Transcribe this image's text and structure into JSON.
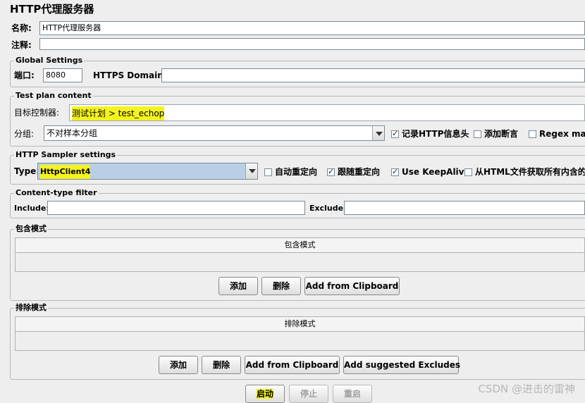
{
  "page": {
    "title": "HTTP代理服务器",
    "name_label": "名称:",
    "name_value": "HTTP代理服务器",
    "comment_label": "注释:",
    "comment_value": ""
  },
  "global_settings": {
    "legend": "Global Settings",
    "port_label": "端口:",
    "port_value": "8080",
    "https_domains_label": "HTTPS Domains :",
    "https_domains_value": ""
  },
  "test_plan_content": {
    "legend": "Test plan content",
    "target_label": "目标控制器:",
    "target_value": "测试计划 > test_echop",
    "grouping_label": "分组:",
    "grouping_value": "不对样本分组",
    "capture_headers_label": "记录HTTP信息头",
    "capture_headers_checked": true,
    "add_assertions_label": "添加断言",
    "add_assertions_checked": false,
    "regex_match_label": "Regex matc",
    "regex_match_checked": false
  },
  "sampler_settings": {
    "legend": "HTTP Sampler settings",
    "type_label": "Type:",
    "type_value": "HttpClient4",
    "auto_redirect_label": "自动重定向",
    "auto_redirect_checked": false,
    "follow_redirects_label": "跟随重定向",
    "follow_redirects_checked": true,
    "keepalive_label": "Use KeepAlive",
    "keepalive_checked": true,
    "retrieve_embedded_label": "从HTML文件获取所有内含的资",
    "retrieve_embedded_checked": false
  },
  "content_type_filter": {
    "legend": "Content-type filter",
    "include_label": "Include:",
    "include_value": "",
    "exclude_label": "Exclude:",
    "exclude_value": ""
  },
  "include_patterns": {
    "legend": "包含模式",
    "column_header": "包含模式",
    "buttons": {
      "add": "添加",
      "delete": "删除",
      "clipboard": "Add from Clipboard"
    }
  },
  "exclude_patterns": {
    "legend": "排除模式",
    "column_header": "排除模式",
    "buttons": {
      "add": "添加",
      "delete": "删除",
      "clipboard": "Add from Clipboard",
      "suggested": "Add suggested Excludes"
    }
  },
  "controls": {
    "start": "启动",
    "stop": "停止",
    "restart": "重启"
  },
  "watermark": "CSDN @进击的雷神",
  "colors": {
    "highlight": "#f5f31f",
    "background": "#eeeeee"
  }
}
